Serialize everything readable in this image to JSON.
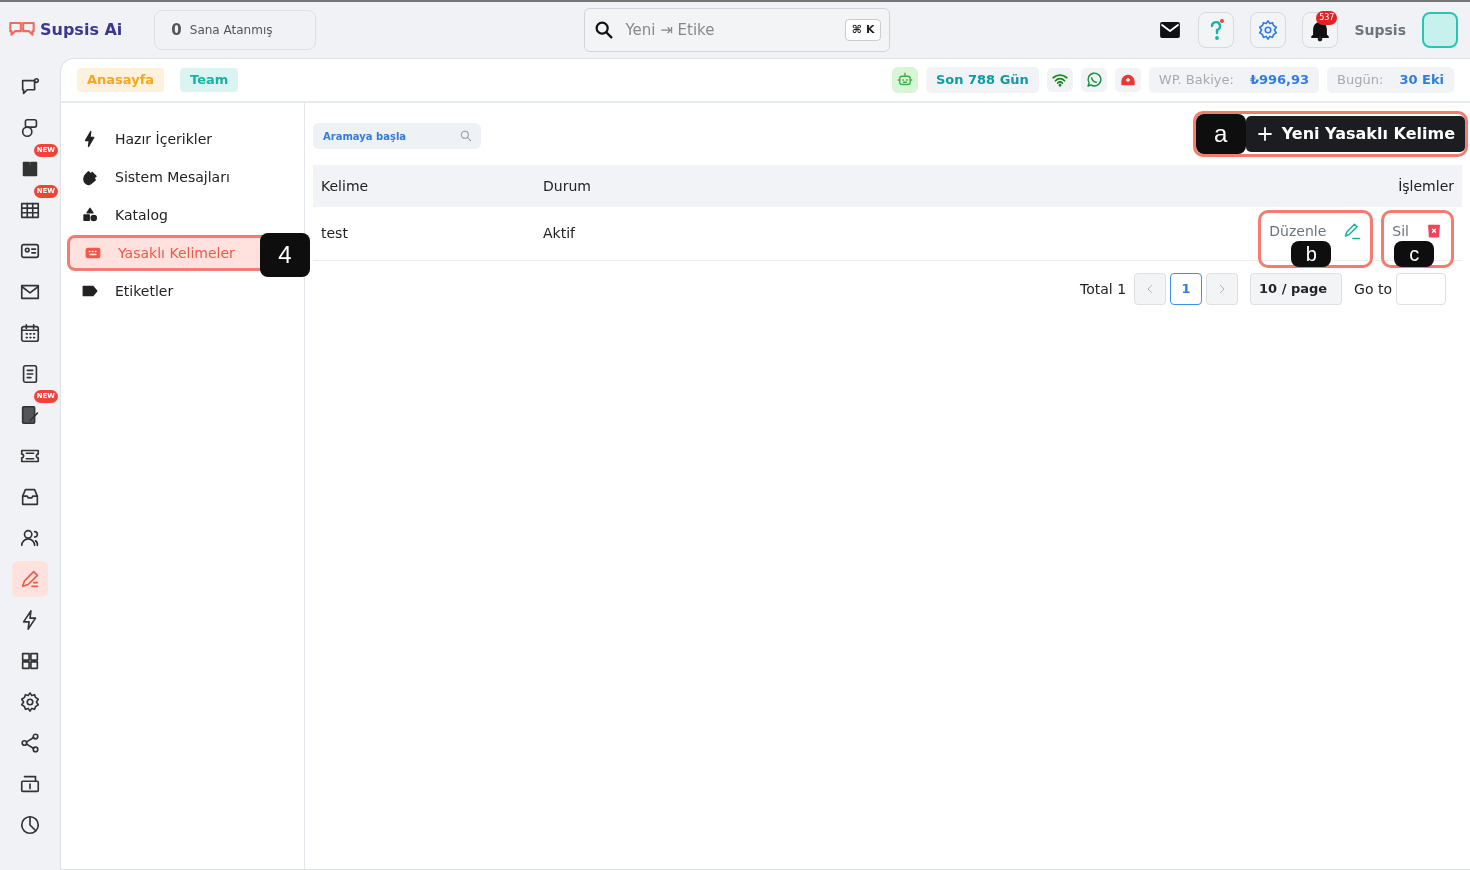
{
  "topbar": {
    "logo": "Supsis Ai",
    "assigned": {
      "count": "0",
      "label": "Sana Atanmış"
    },
    "search": {
      "value": "Yeni ⇥ Etike",
      "shortcut": "⌘ K"
    },
    "notification_count": "537",
    "user": "Supsis"
  },
  "tabs": [
    {
      "label": "Anasayfa",
      "color": "#f5a623"
    },
    {
      "label": "Team",
      "color": "#17b3a3"
    }
  ],
  "status": {
    "days": "Son 788 Gün",
    "balance_label": "WP. Bakiye:",
    "balance": "₺996,93",
    "today_label": "Bugün:",
    "today": "30 Eki"
  },
  "rail": [
    {
      "selected": false
    },
    {
      "selected": false
    },
    {
      "selected": false,
      "badge": "NEW"
    },
    {
      "selected": false,
      "badge": "NEW"
    },
    {
      "selected": false
    },
    {
      "selected": false
    },
    {
      "selected": false
    },
    {
      "selected": false
    },
    {
      "selected": false,
      "badge": "NEW"
    },
    {
      "selected": false
    },
    {
      "selected": false
    },
    {
      "selected": false
    },
    {
      "selected": true
    },
    {
      "selected": false
    },
    {
      "selected": false
    },
    {
      "selected": false
    },
    {
      "selected": false
    },
    {
      "selected": false
    },
    {
      "selected": false
    }
  ],
  "submenu": [
    {
      "label": "Hazır İçerikler",
      "selected": false
    },
    {
      "label": "Sistem Mesajları",
      "selected": false
    },
    {
      "label": "Katalog",
      "selected": false
    },
    {
      "label": "Yasaklı Kelimeler",
      "selected": true,
      "callout": "4"
    },
    {
      "label": "Etiketler",
      "selected": false
    }
  ],
  "search": {
    "placeholder": "Aramaya başla"
  },
  "new_button": {
    "label": "Yeni Yasaklı Kelime",
    "callout": "a"
  },
  "table": {
    "columns": [
      "Kelime",
      "Durum",
      "İşlemler"
    ],
    "rows": [
      {
        "word": "test",
        "status": "Aktif",
        "edit": {
          "label": "Düzenle",
          "callout": "b"
        },
        "delete": {
          "label": "Sil",
          "callout": "c"
        }
      }
    ]
  },
  "pagination": {
    "total": "Total 1",
    "pages": [
      {
        "label": "1",
        "selected": true
      }
    ],
    "page_size": "10 / page",
    "goto": "Go to"
  }
}
